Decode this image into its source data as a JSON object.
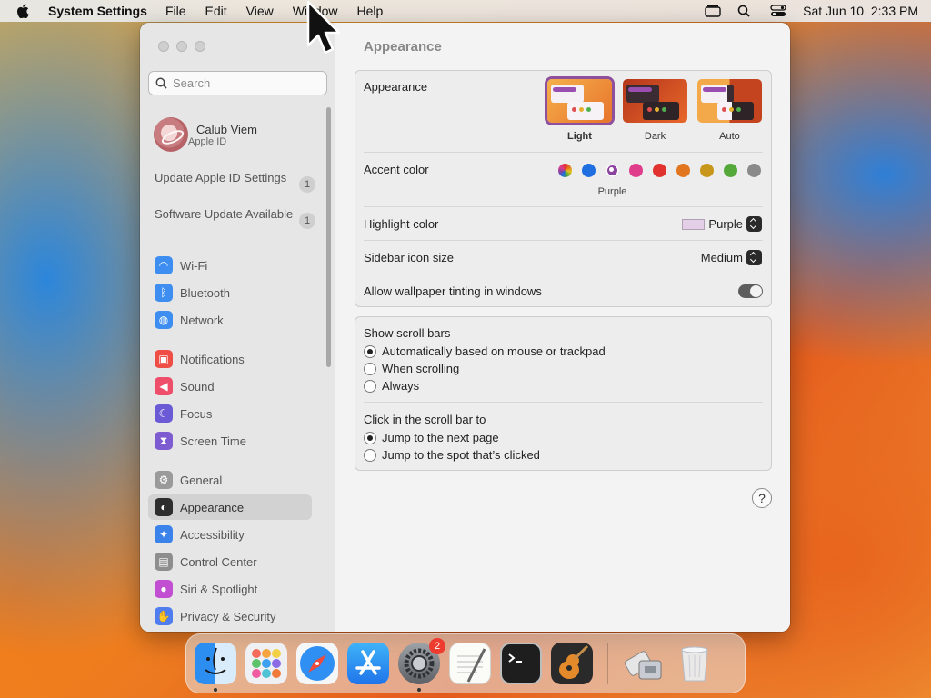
{
  "menubar": {
    "app_name": "System Settings",
    "items": [
      "File",
      "Edit",
      "View",
      "Window",
      "Help"
    ],
    "clock": "Sat Jun 10  2:33 PM"
  },
  "sidebar": {
    "search_placeholder": "Search",
    "profile": {
      "name": "Calub Viem",
      "subtitle": "Apple ID"
    },
    "notices": [
      {
        "label": "Update Apple ID Settings",
        "badge": "1"
      },
      {
        "label": "Software Update Available",
        "badge": "1"
      }
    ],
    "groups": [
      [
        {
          "label": "Wi-Fi",
          "icon": "wifi-icon",
          "color": "#3d8ef0"
        },
        {
          "label": "Bluetooth",
          "icon": "bluetooth-icon",
          "color": "#3d8ef0"
        },
        {
          "label": "Network",
          "icon": "globe-icon",
          "color": "#3d8ef0"
        }
      ],
      [
        {
          "label": "Notifications",
          "icon": "bell-icon",
          "color": "#ef4e47"
        },
        {
          "label": "Sound",
          "icon": "speaker-icon",
          "color": "#ef4e6a"
        },
        {
          "label": "Focus",
          "icon": "moon-icon",
          "color": "#6a5ad6"
        },
        {
          "label": "Screen Time",
          "icon": "hourglass-icon",
          "color": "#7d5bd0"
        }
      ],
      [
        {
          "label": "General",
          "icon": "gear-icon",
          "color": "#9a9a9a"
        },
        {
          "label": "Appearance",
          "icon": "appearance-icon",
          "color": "#2d2d2d"
        },
        {
          "label": "Accessibility",
          "icon": "accessibility-icon",
          "color": "#3b83ea"
        },
        {
          "label": "Control Center",
          "icon": "control-center-icon",
          "color": "#8e8e8e"
        },
        {
          "label": "Siri & Spotlight",
          "icon": "siri-icon",
          "color": "#c24fd1"
        },
        {
          "label": "Privacy & Security",
          "icon": "hand-icon",
          "color": "#4f7df0"
        }
      ]
    ],
    "active": "Appearance"
  },
  "main": {
    "title": "Appearance",
    "appearance": {
      "label": "Appearance",
      "options": [
        "Light",
        "Dark",
        "Auto"
      ],
      "selected": "Light"
    },
    "accent": {
      "label": "Accent color",
      "selected_name": "Purple",
      "colors": [
        "multicolor",
        "#1f6fe0",
        "#8c43a0",
        "#e03c8c",
        "#e2322f",
        "#e2761f",
        "#c8961a",
        "#55a93a",
        "#8a8a8a"
      ],
      "selected_index": 2
    },
    "highlight": {
      "label": "Highlight color",
      "value": "Purple",
      "swatch": "#e3cfe6"
    },
    "icon_size": {
      "label": "Sidebar icon size",
      "value": "Medium"
    },
    "tinting": {
      "label": "Allow wallpaper tinting in windows",
      "on": true
    },
    "scroll_bars": {
      "label": "Show scroll bars",
      "options": [
        "Automatically based on mouse or trackpad",
        "When scrolling",
        "Always"
      ],
      "selected_index": 0
    },
    "click_scroll": {
      "label": "Click in the scroll bar to",
      "options": [
        "Jump to the next page",
        "Jump to the spot that’s clicked"
      ],
      "selected_index": 0
    },
    "help": "?"
  },
  "dock": {
    "apps": [
      {
        "name": "finder-icon",
        "running": true
      },
      {
        "name": "launchpad-icon",
        "running": false
      },
      {
        "name": "safari-icon",
        "running": false
      },
      {
        "name": "app-store-icon",
        "running": false
      },
      {
        "name": "system-settings-icon",
        "running": true,
        "badge": "2"
      },
      {
        "name": "textedit-icon",
        "running": false
      },
      {
        "name": "terminal-icon",
        "running": false
      },
      {
        "name": "garageband-icon",
        "running": false
      }
    ],
    "others": [
      "migration-assistant-icon",
      "trash-icon"
    ]
  }
}
